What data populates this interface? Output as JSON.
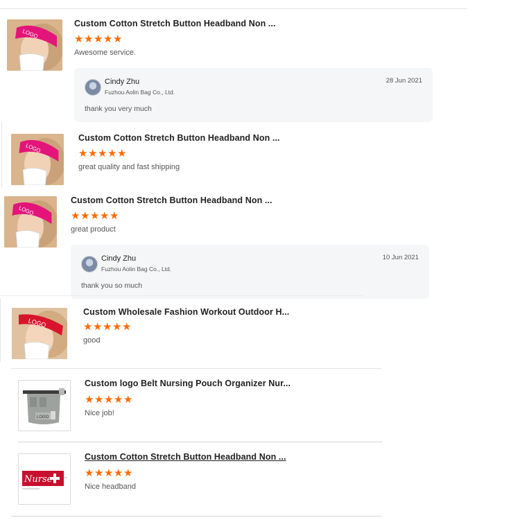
{
  "reviews": [
    {
      "title": "Custom Cotton Stretch Button Headband Non ...",
      "rating": 5,
      "comment": "Awesome service.",
      "thumb_icon": "headband-pink-logo",
      "reply": {
        "name": "Cindy Zhu",
        "company": "Fuzhou Aolin Bag Co., Ltd.",
        "date": "28 Jun 2021",
        "text": "thank you very much"
      }
    },
    {
      "title": "Custom Cotton Stretch Button Headband Non ...",
      "rating": 5,
      "comment": "great quality and fast shipping",
      "thumb_icon": "headband-pink-logo"
    },
    {
      "title": "Custom Cotton Stretch Button Headband Non ...",
      "rating": 5,
      "comment": "great product",
      "thumb_icon": "headband-pink-logo",
      "reply": {
        "name": "Cindy Zhu",
        "company": "Fuzhou Aolin Bag Co., Ltd.",
        "date": "10 Jun 2021",
        "text": "thank you so much"
      }
    },
    {
      "title": "Custom Wholesale Fashion Workout Outdoor H...",
      "rating": 5,
      "comment": "good",
      "thumb_icon": "headband-red-logo"
    },
    {
      "title": "Custom logo Belt Nursing Pouch Organizer Nur...",
      "rating": 5,
      "comment": "Nice job!",
      "thumb_icon": "nursing-pouch",
      "thumb_text": "LOGO"
    },
    {
      "title": "Custom Cotton Stretch Button Headband Non ...",
      "rating": 5,
      "comment": "Nice headband",
      "thumb_icon": "nurse-headband",
      "thumb_text": "Nurse"
    }
  ],
  "colors": {
    "star": "#ff6a00",
    "reply_bg": "#f5f6f8",
    "rule": "#e3e3e3"
  }
}
